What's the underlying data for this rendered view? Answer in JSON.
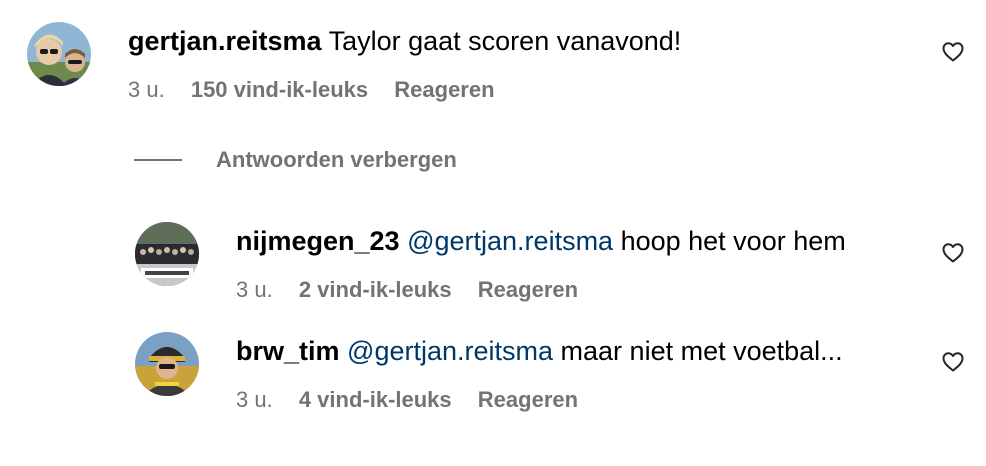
{
  "comments": [
    {
      "username": "gertjan.reitsma",
      "text": "Taylor gaat scoren vanavond!",
      "time": "3 u.",
      "likes": "150 vind-ik-leuks",
      "reply_label": "Reageren",
      "like_icon": "heart-outline-icon"
    }
  ],
  "toggle_replies_label": "Antwoorden verbergen",
  "replies": [
    {
      "username": "nijmegen_23",
      "mention": "@gertjan.reitsma",
      "text": " hoop het voor hem",
      "time": "3 u.",
      "likes": "2 vind-ik-leuks",
      "reply_label": "Reageren",
      "like_icon": "heart-outline-icon"
    },
    {
      "username": "brw_tim",
      "mention": "@gertjan.reitsma",
      "text": " maar niet met voetbal...",
      "time": "3 u.",
      "likes": "4 vind-ik-leuks",
      "reply_label": "Reageren",
      "like_icon": "heart-outline-icon"
    }
  ],
  "colors": {
    "text": "#000000",
    "secondary": "#737373",
    "mention": "#00376b"
  }
}
